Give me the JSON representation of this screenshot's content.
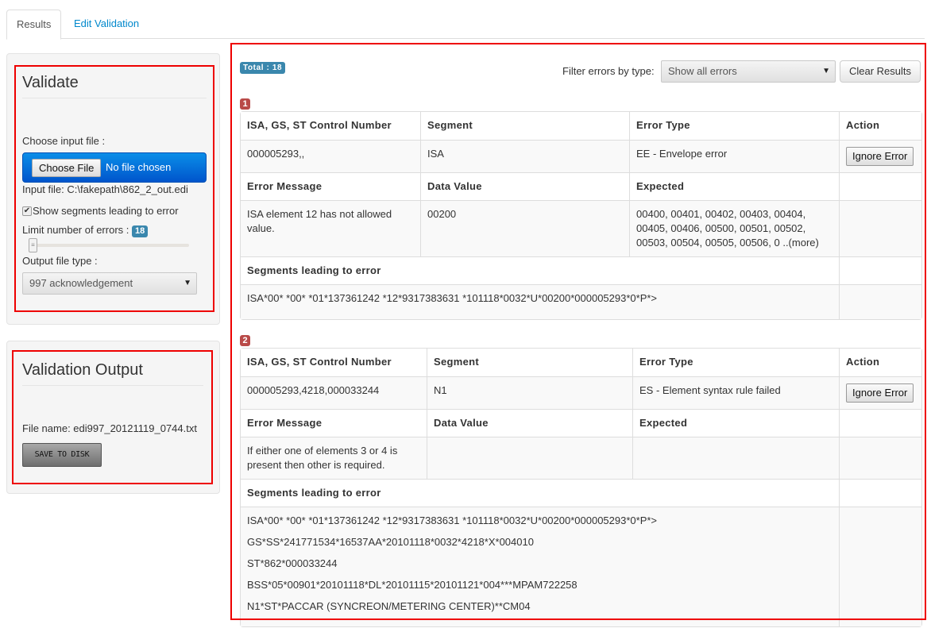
{
  "tabs": [
    {
      "label": "Results",
      "active": true
    },
    {
      "label": "Edit Validation",
      "active": false
    }
  ],
  "validate": {
    "title": "Validate",
    "choose_input_label": "Choose input file :",
    "choose_file_button": "Choose File",
    "file_status": "No file chosen",
    "input_file_text": "Input file: C:\\fakepath\\862_2_out.edi",
    "show_segments_label": "Show segments leading to error",
    "show_segments_checked": true,
    "limit_label": "Limit number of errors :",
    "limit_value": "18",
    "output_type_label": "Output file type :",
    "output_type_selected": "997 acknowledgement"
  },
  "output": {
    "title": "Validation Output",
    "file_name_text": "File name: edi997_20121119_0744.txt",
    "save_button": "SAVE TO DISK"
  },
  "results": {
    "total_badge": "Total : 18",
    "filter_label": "Filter errors by type:",
    "filter_selected": "Show all errors",
    "clear_button": "Clear Results",
    "headers": {
      "control_number": "ISA, GS, ST Control Number",
      "segment": "Segment",
      "error_type": "Error Type",
      "action": "Action",
      "error_message": "Error Message",
      "data_value": "Data Value",
      "expected": "Expected",
      "segments_leading": "Segments leading to error"
    },
    "ignore_button": "Ignore Error",
    "errors": [
      {
        "number": "1",
        "control_number": "000005293,,",
        "segment": "ISA",
        "error_type": "EE - Envelope error",
        "error_message": "ISA element 12 has not allowed value.",
        "data_value": "00200",
        "expected": "00400, 00401, 00402, 00403, 00404, 00405, 00406, 00500, 00501, 00502, 00503, 00504, 00505, 00506, 0 ..(more)",
        "segments": [
          "ISA*00* *00* *01*137361242 *12*9317383631 *101118*0032*U*00200*000005293*0*P*>"
        ]
      },
      {
        "number": "2",
        "control_number": "000005293,4218,000033244",
        "segment": "N1",
        "error_type": "ES - Element syntax rule failed",
        "error_message": "If either one of elements 3 or 4 is present then other is required.",
        "data_value": "",
        "expected": "",
        "segments": [
          "ISA*00* *00* *01*137361242 *12*9317383631 *101118*0032*U*00200*000005293*0*P*>",
          "GS*SS*241771534*16537AA*20101118*0032*4218*X*004010",
          "ST*862*000033244",
          "BSS*05*00901*20101118*DL*20101115*20101121*004***MPAM722258",
          "N1*ST*PACCAR (SYNCREON/METERING CENTER)**CM04"
        ]
      }
    ]
  }
}
